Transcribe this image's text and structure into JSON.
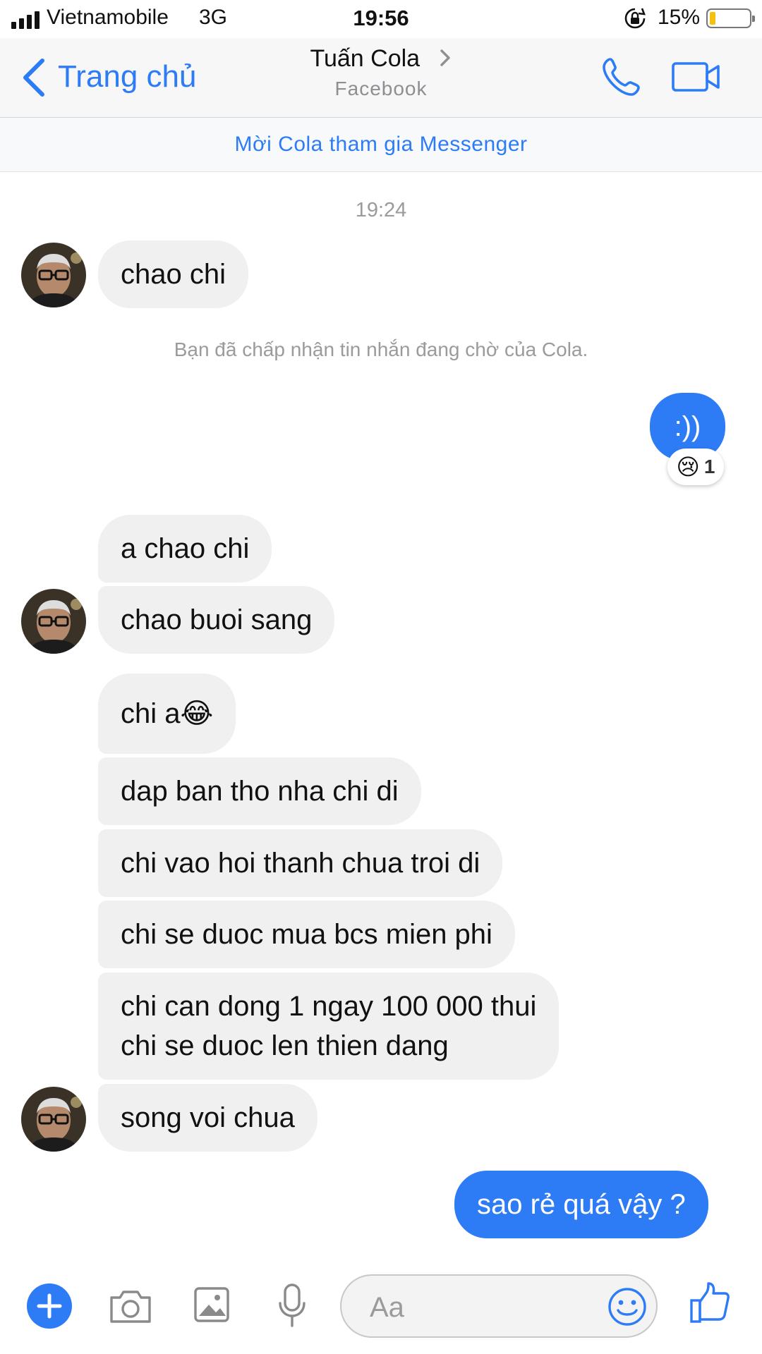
{
  "status_bar": {
    "carrier": "Vietnamobile",
    "network": "3G",
    "time": "19:56",
    "battery": "15%",
    "battery_level": 0.15
  },
  "header": {
    "back_label": "Trang chủ",
    "contact_name": "Tuấn Cola",
    "contact_subtitle": "Facebook",
    "call_icon": "phone-icon",
    "video_icon": "video-camera-icon"
  },
  "invite_banner": "Mời Cola tham gia Messenger",
  "conversation": {
    "timestamp": "19:24",
    "system_note": "Bạn đã chấp nhận tin nhắn đang chờ của Cola.",
    "messages": [
      {
        "from": "contact",
        "text": "chao chi"
      },
      {
        "from": "me",
        "text": ":))",
        "reaction": {
          "emoji": "😢",
          "count": "1"
        }
      },
      {
        "from": "contact",
        "text": "a chao chi"
      },
      {
        "from": "contact",
        "text": "chao buoi sang"
      },
      {
        "from": "contact",
        "text": "chi a😂"
      },
      {
        "from": "contact",
        "text": "dap ban tho nha chi di"
      },
      {
        "from": "contact",
        "text": "chi vao hoi thanh chua troi di"
      },
      {
        "from": "contact",
        "text": "chi se duoc mua bcs mien phi"
      },
      {
        "from": "contact",
        "lines": [
          "chi can dong 1 ngay 100 000 thui",
          "chi se duoc len thien dang"
        ]
      },
      {
        "from": "contact",
        "text": "song voi chua"
      },
      {
        "from": "me",
        "text": "sao rẻ quá vậy ?"
      }
    ]
  },
  "composer": {
    "placeholder": "Aa",
    "icons": [
      "plus-icon",
      "camera-icon",
      "image-icon",
      "microphone-icon",
      "emoji-icon",
      "like-icon"
    ]
  },
  "colors": {
    "accent": "#2d7cf6",
    "incoming_bubble": "#f0f0f0",
    "battery_fill": "#f4c20d"
  }
}
